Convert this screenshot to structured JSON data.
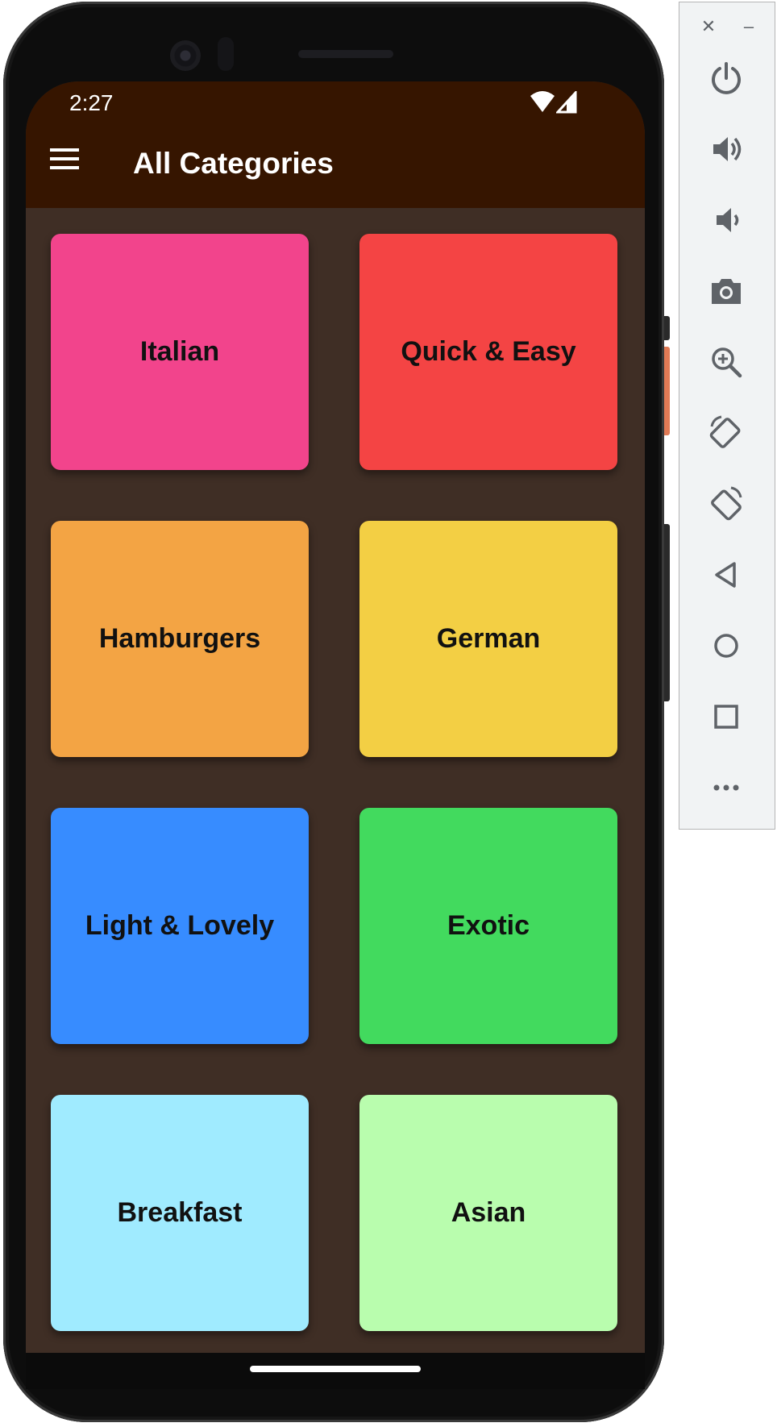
{
  "status_bar": {
    "time": "2:27"
  },
  "app_bar": {
    "title": "All Categories"
  },
  "categories": [
    {
      "label": "Italian",
      "color": "#f2448c"
    },
    {
      "label": "Quick & Easy",
      "color": "#f44444"
    },
    {
      "label": "Hamburgers",
      "color": "#f3a444"
    },
    {
      "label": "German",
      "color": "#f3cf44"
    },
    {
      "label": "Light & Lovely",
      "color": "#378cff"
    },
    {
      "label": "Exotic",
      "color": "#42da5e"
    },
    {
      "label": "Breakfast",
      "color": "#a0ebff"
    },
    {
      "label": "Asian",
      "color": "#b9fdae"
    }
  ],
  "theme": {
    "app_bar_color": "#361500",
    "background_color": "#3f2e25"
  },
  "emulator_toolbar": {
    "window_controls": [
      "close-icon",
      "minimize-icon"
    ],
    "buttons": [
      "power-icon",
      "volume-up-icon",
      "volume-down-icon",
      "camera-icon",
      "zoom-icon",
      "rotate-left-icon",
      "rotate-right-icon",
      "back-icon",
      "home-icon",
      "overview-icon",
      "more-icon"
    ]
  }
}
